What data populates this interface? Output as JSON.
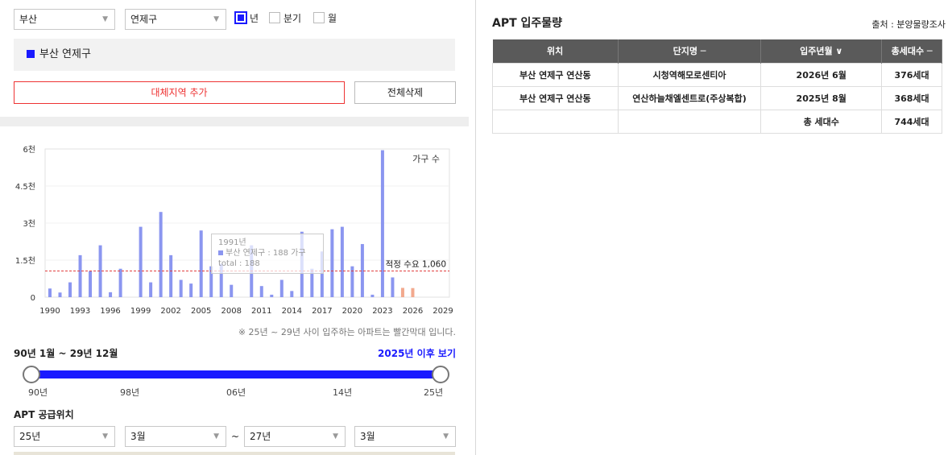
{
  "filters": {
    "city": "부산",
    "district": "연제구",
    "period_options": [
      {
        "label": "년",
        "checked": true
      },
      {
        "label": "분기",
        "checked": false
      },
      {
        "label": "월",
        "checked": false
      }
    ]
  },
  "region_list": [
    "부산 연제구"
  ],
  "buttons": {
    "add_region": "대체지역 추가",
    "delete_all": "전체삭제"
  },
  "chart_data": {
    "type": "bar",
    "legend": "가구 수",
    "y_ticks": [
      "6천",
      "4.5천",
      "3천",
      "1.5천",
      "0"
    ],
    "ylim": [
      0,
      6000
    ],
    "x_ticks": [
      "1990",
      "1993",
      "1996",
      "1999",
      "2002",
      "2005",
      "2008",
      "2011",
      "2014",
      "2017",
      "2020",
      "2023",
      "2026",
      "2029"
    ],
    "x": [
      1990,
      1991,
      1992,
      1993,
      1994,
      1995,
      1996,
      1997,
      1998,
      1999,
      2000,
      2001,
      2002,
      2003,
      2004,
      2005,
      2006,
      2007,
      2008,
      2009,
      2010,
      2011,
      2012,
      2013,
      2014,
      2015,
      2016,
      2017,
      2018,
      2019,
      2020,
      2021,
      2022,
      2023,
      2024,
      2025,
      2026,
      2027,
      2028,
      2029
    ],
    "values": [
      350,
      188,
      600,
      1700,
      1050,
      2100,
      200,
      1150,
      0,
      2850,
      600,
      3450,
      1700,
      700,
      550,
      2700,
      1250,
      1350,
      500,
      0,
      2100,
      450,
      100,
      700,
      250,
      2650,
      1150,
      1850,
      2750,
      2850,
      1250,
      2150,
      100,
      5950,
      800,
      376,
      368,
      0,
      0,
      0
    ],
    "colors": {
      "past": "#8b96f0",
      "future": "#f2a98e"
    },
    "reference_line": {
      "label": "적정 수요 1,060",
      "value": 1060,
      "color": "#e04040"
    },
    "tooltip": {
      "year": "1991년",
      "line1": "부산 연제구 : 188 가구",
      "line2": "total : 188"
    }
  },
  "chart_note": "※ 25년 ~ 29년 사이 입주하는 아파트는 빨간막대 입니다.",
  "range": {
    "label": "90년 1월 ~ 29년 12월",
    "link": "2025년 이후 보기",
    "ticks": [
      "90년",
      "98년",
      "06년",
      "14년",
      "25년"
    ]
  },
  "supply": {
    "title": "APT 공급위치",
    "from_year": "25년",
    "from_month": "3월",
    "to_year": "27년",
    "to_month": "3월",
    "sep": "~"
  },
  "right": {
    "title": "APT 입주물량",
    "source": "출처 : 분양물량조사",
    "headers": [
      "위치",
      "단지명 ─",
      "입주년월 ∨",
      "총세대수 ─"
    ],
    "rows": [
      [
        "부산 연제구 연산동",
        "시청역해모로센티아",
        "2026년 6월",
        "376세대"
      ],
      [
        "부산 연제구 연산동",
        "연산하늘채엘센트로(주상복합)",
        "2025년 8월",
        "368세대"
      ],
      [
        "",
        "",
        "총 세대수",
        "744세대"
      ]
    ]
  }
}
